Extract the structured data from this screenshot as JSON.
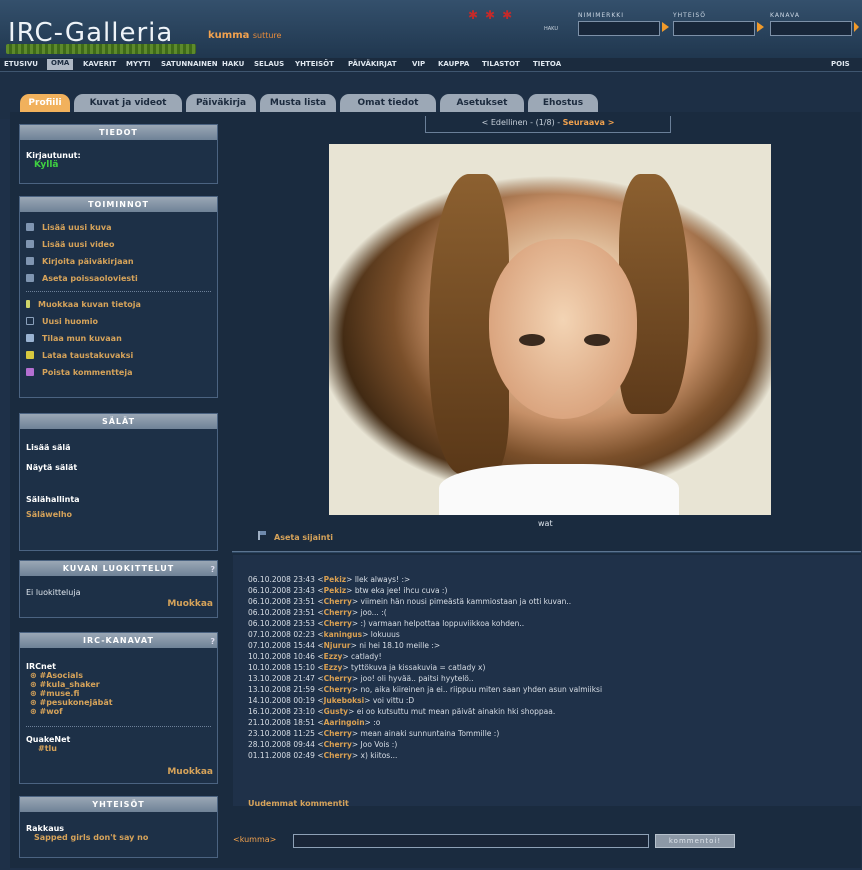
{
  "header": {
    "logo": "IRC-Galleria",
    "username": "kumma",
    "user_tag": "sutture",
    "search_labels": [
      "NIMIMERKKI",
      "YHTEISÖ",
      "KANAVA"
    ],
    "haku_label": "HAKU"
  },
  "nav": [
    "ETUSIVU",
    "OMA",
    "KAVERIT",
    "MYYTI",
    "SATUNNAINEN",
    "HAKU",
    "SELAUS",
    "YHTEISÖT",
    "PÄIVÄKIRJAT",
    "VIP",
    "KAUPPA",
    "TILASTOT",
    "TIETOA",
    "POIS"
  ],
  "tabs": [
    "Profiili",
    "Kuvat ja videot",
    "Päiväkirja",
    "Musta lista",
    "Omat tiedot",
    "Asetukset",
    "Ehostus"
  ],
  "tiedot": {
    "title": "TIEDOT",
    "label": "Kirjautunut:",
    "value": "Kyllä"
  },
  "toiminnot": {
    "title": "TOIMINNOT",
    "items": [
      "Lisää uusi kuva",
      "Lisää uusi video",
      "Kirjoita päiväkirjaan",
      "Aseta poissaoloviesti",
      "Muokkaa kuvan tietoja",
      "Uusi huomio",
      "Tilaa mun kuvaan",
      "Lataa taustakuvaksi",
      "Poista kommentteja"
    ],
    "icon_colors": [
      "#7f95b1",
      "#7f95b1",
      "#7f95b1",
      "#7f95b1",
      "#cfd56a",
      "#8aa0bb",
      "#9ab3d2",
      "#d7c83f",
      "#b46fd1"
    ]
  },
  "salat": {
    "title": "SÄLÄT",
    "add": "Lisää sälä",
    "show": "Näytä sälät",
    "mgmt": "Sälähallinta",
    "link": "Säläwelho"
  },
  "luokittelut": {
    "title": "KUVAN LUOKITTELUT",
    "q": "?",
    "text": "Ei luokitteluja",
    "edit": "Muokkaa"
  },
  "kanavat": {
    "title": "IRC-KANAVAT",
    "q": "?",
    "net1": "IRCnet",
    "channels1": [
      "#Asocials",
      "#kula_shaker",
      "#muse.fi",
      "#pesukonejäbät",
      "#wof"
    ],
    "net2": "QuakeNet",
    "channels2": [
      "#tlu"
    ],
    "edit": "Muokkaa"
  },
  "yhteisot": {
    "title": "YHTEISÖT",
    "label": "Rakkaus",
    "value": "Sapped girls don't say no"
  },
  "pager": {
    "prev": "< Edellinen",
    "mid": " - (1/8) - ",
    "next": "Seuraava >"
  },
  "photo": {
    "caption": "wat",
    "location": "Aseta sijainti"
  },
  "comments": [
    {
      "t": "06.10.2008 23:43",
      "n": "Pekiz",
      "m": "llek always! :>"
    },
    {
      "t": "06.10.2008 23:43",
      "n": "Pekiz",
      "m": "btw eka jee! ihcu cuva :)"
    },
    {
      "t": "06.10.2008 23:51",
      "n": "Cherry",
      "m": "viimein hän nousi pimeästä kammiostaan ja otti kuvan.."
    },
    {
      "t": "06.10.2008 23:51",
      "n": "Cherry",
      "m": "joo... :("
    },
    {
      "t": "06.10.2008 23:53",
      "n": "Cherry",
      "m": ":) varmaan helpottaa loppuviikkoa kohden.."
    },
    {
      "t": "07.10.2008 02:23",
      "n": "kaningus",
      "m": "lokuuus"
    },
    {
      "t": "07.10.2008 15:44",
      "n": "Njurur",
      "m": "ni hei 18.10 meille :>"
    },
    {
      "t": "10.10.2008 10:46",
      "n": "Ezzy",
      "m": "catlady!"
    },
    {
      "t": "10.10.2008 15:10",
      "n": "Ezzy",
      "m": "tyttökuva ja kissakuvia = catlady x)"
    },
    {
      "t": "13.10.2008 21:47",
      "n": "Cherry",
      "m": "joo! oli hyvää.. paitsi hyytelö.."
    },
    {
      "t": "13.10.2008 21:59",
      "n": "Cherry",
      "m": "no, aika kiireinen ja ei.. riippuu miten saan yhden asun valmiiksi"
    },
    {
      "t": "14.10.2008 00:19",
      "n": "Jukeboksi",
      "m": "voi vittu :D"
    },
    {
      "t": "16.10.2008 23:10",
      "n": "Gusty",
      "m": "ei oo kutsuttu mut mean päivät ainakin hki shoppaa."
    },
    {
      "t": "21.10.2008 18:51",
      "n": "Aaringoin",
      "m": ":o"
    },
    {
      "t": "23.10.2008 11:25",
      "n": "Cherry",
      "m": "mean ainaki sunnuntaina Tommille :)"
    },
    {
      "t": "28.10.2008 09:44",
      "n": "Cherry",
      "m": "Joo Vois :)"
    },
    {
      "t": "01.11.2008 02:49",
      "n": "Cherry",
      "m": "x) kiitos..."
    }
  ],
  "newer": "Uudemmat kommentit",
  "compose": {
    "user": "<kumma>",
    "button": "kommentoi!"
  }
}
